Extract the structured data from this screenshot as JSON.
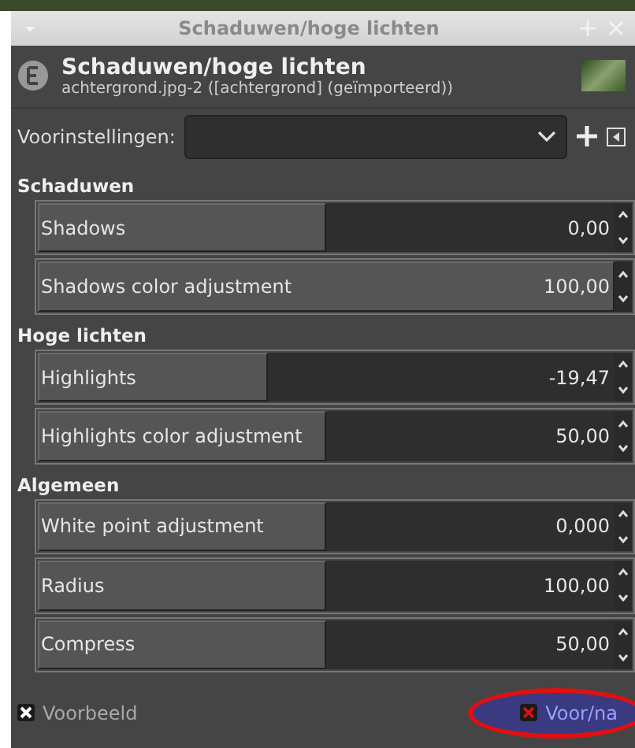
{
  "window": {
    "title": "Schaduwen/hoge lichten"
  },
  "header": {
    "title": "Schaduwen/hoge lichten",
    "subtitle": "achtergrond.jpg-2 ([achtergrond] (geïmporteerd))"
  },
  "presets": {
    "label": "Voorinstellingen:"
  },
  "sections": [
    {
      "title": "Schaduwen",
      "sliders": [
        {
          "label": "Shadows",
          "value": "0,00",
          "level": 0.5
        },
        {
          "label": "Shadows color adjustment",
          "value": "100,00",
          "level": 1
        }
      ]
    },
    {
      "title": "Hoge lichten",
      "sliders": [
        {
          "label": "Highlights",
          "value": "-19,47",
          "level": 0.4
        },
        {
          "label": "Highlights color adjustment",
          "value": "50,00",
          "level": 0.5
        }
      ]
    },
    {
      "title": "Algemeen",
      "sliders": [
        {
          "label": "White point adjustment",
          "value": "0,000",
          "level": 0.5
        },
        {
          "label": "Radius",
          "value": "100,00",
          "level": 0.5
        },
        {
          "label": "Compress",
          "value": "50,00",
          "level": 0.5
        }
      ]
    }
  ],
  "footer": {
    "preview": {
      "label": "Voorbeeld",
      "checked": true
    },
    "split": {
      "label": "Voor/na",
      "checked": true
    }
  }
}
